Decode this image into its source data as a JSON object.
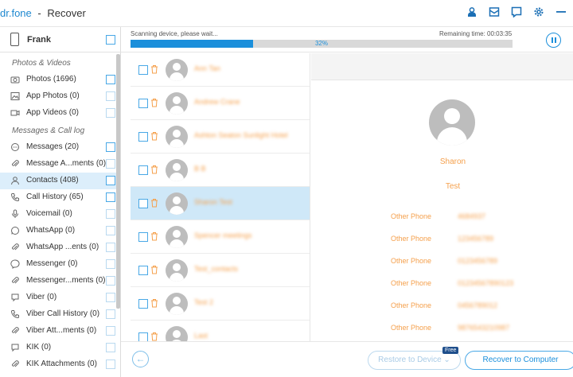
{
  "app": {
    "brand": "dr.fone",
    "separator": "-",
    "title": "Recover"
  },
  "titlebar_icons": [
    "user-icon",
    "mail-icon",
    "chat-icon",
    "settings-icon",
    "menu-icon"
  ],
  "device": {
    "name": "Frank"
  },
  "sidebar": {
    "categories": {
      "photos": "Photos & Videos",
      "messages": "Messages & Call log"
    },
    "items": [
      {
        "label": "Photos (1696)",
        "icon": "camera-icon"
      },
      {
        "label": "App Photos (0)",
        "icon": "image-icon"
      },
      {
        "label": "App Videos (0)",
        "icon": "video-icon"
      },
      {
        "label": "Messages (20)",
        "icon": "message-icon"
      },
      {
        "label": "Message A...ments (0)",
        "icon": "attachment-icon"
      },
      {
        "label": "Contacts (408)",
        "icon": "contact-icon",
        "active": true
      },
      {
        "label": "Call History (65)",
        "icon": "phone-icon"
      },
      {
        "label": "Voicemail (0)",
        "icon": "microphone-icon"
      },
      {
        "label": "WhatsApp (0)",
        "icon": "whatsapp-icon"
      },
      {
        "label": "WhatsApp ...ents (0)",
        "icon": "attachment-icon"
      },
      {
        "label": "Messenger (0)",
        "icon": "messenger-icon"
      },
      {
        "label": "Messenger...ments (0)",
        "icon": "attachment-icon"
      },
      {
        "label": "Viber (0)",
        "icon": "viber-icon"
      },
      {
        "label": "Viber Call History (0)",
        "icon": "phone-icon"
      },
      {
        "label": "Viber Att...ments (0)",
        "icon": "attachment-icon"
      },
      {
        "label": "KIK (0)",
        "icon": "kik-icon"
      },
      {
        "label": "KIK Attachments (0)",
        "icon": "attachment-icon"
      }
    ]
  },
  "scan": {
    "status": "Scanning device, please wait...",
    "remaining": "Remaining time: 00:03:35",
    "progress_label": "32%",
    "progress_value": 0.32
  },
  "contacts": [
    {
      "name": "Ann Tan"
    },
    {
      "name": "Andrew Crane"
    },
    {
      "name": "Ashton Seaton Sunlight Hotel"
    },
    {
      "name": "B B"
    },
    {
      "name": "Sharon Test",
      "selected": true
    },
    {
      "name": "Spencer meetings"
    },
    {
      "name": "Test_contacts"
    },
    {
      "name": "Test 2"
    },
    {
      "name": "Last"
    }
  ],
  "detail": {
    "name": "Sharon",
    "subtitle": "Test",
    "phones": [
      {
        "label": "Other Phone",
        "value": "4684937"
      },
      {
        "label": "Other Phone",
        "value": "123456789"
      },
      {
        "label": "Other Phone",
        "value": "0123456789"
      },
      {
        "label": "Other Phone",
        "value": "01234567890123"
      },
      {
        "label": "Other Phone",
        "value": "0456789012"
      },
      {
        "label": "Other Phone",
        "value": "9876543210987"
      }
    ]
  },
  "bottom": {
    "restore_label": "Restore to Device ⌄",
    "free_badge": "Free",
    "recover_label": "Recover to Computer"
  },
  "colors": {
    "accent": "#1b8fdb",
    "orange": "#f5a04c",
    "selection": "#cfe8f8"
  }
}
